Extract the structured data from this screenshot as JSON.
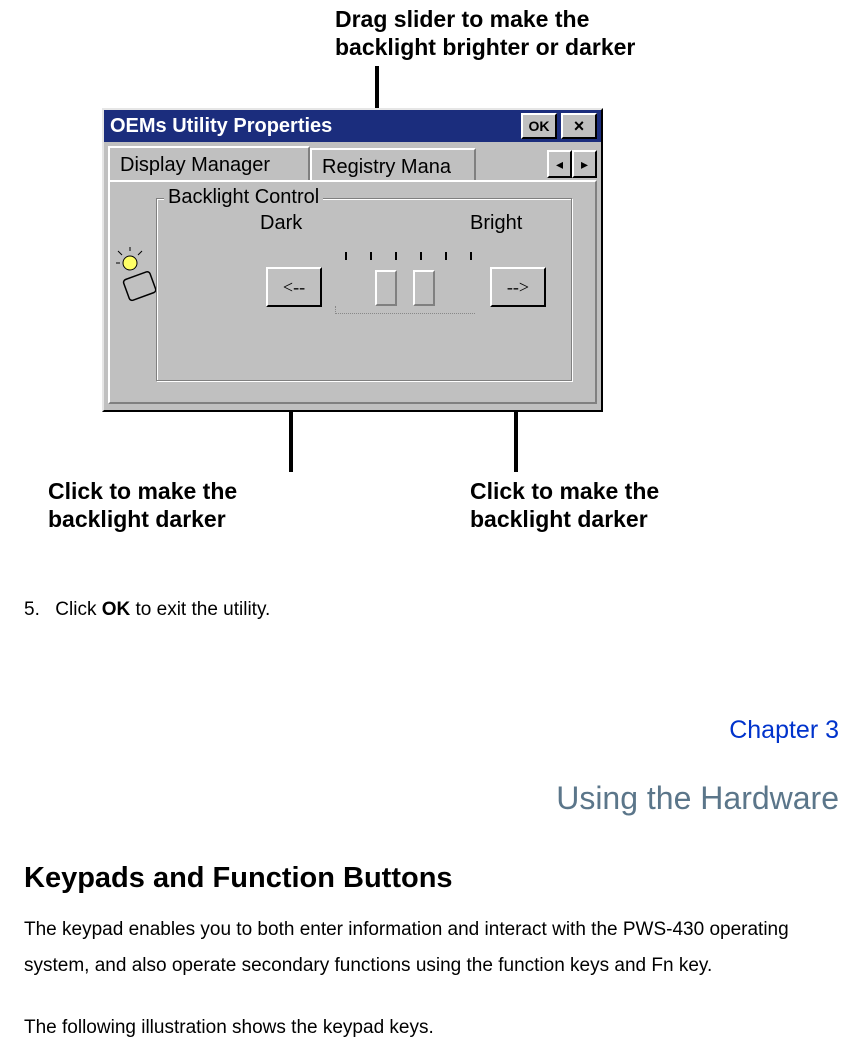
{
  "annotations": {
    "top": "Drag slider to make the backlight brighter or darker",
    "left": "Click to make the backlight darker",
    "right": "Click to make the backlight darker"
  },
  "dialog": {
    "title": "OEMs Utility Properties",
    "ok": "OK",
    "close": "×",
    "tabs": {
      "active": "Display Manager",
      "inactive": "Registry Mana",
      "scroll_left": "◂",
      "scroll_right": "▸"
    },
    "group": {
      "legend": "Backlight Control",
      "dark": "Dark",
      "bright": "Bright",
      "left_btn": "<--",
      "right_btn": "-->"
    }
  },
  "body": {
    "step_num": "5.",
    "step_pre": "Click ",
    "step_bold": "OK",
    "step_post": " to exit the utility.",
    "chapter": "Chapter 3",
    "chapter_title": "Using the Hardware",
    "h2": "Keypads and Function Buttons",
    "p1": "The keypad enables you to both enter information and interact with the PWS-430 operating system, and also operate secondary functions using the function keys and Fn key.",
    "p2": "The following illustration shows the keypad keys."
  }
}
